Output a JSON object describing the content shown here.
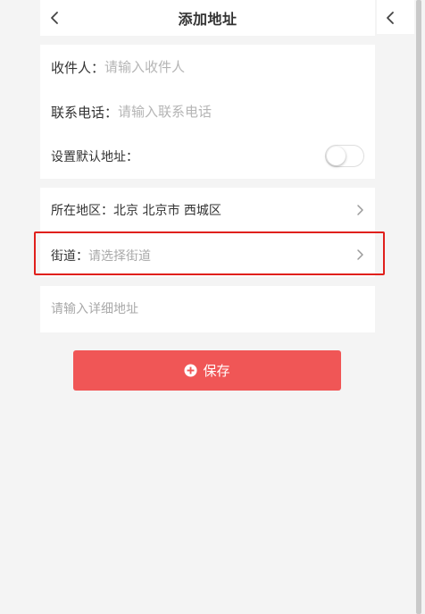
{
  "header": {
    "title": "添加地址",
    "back_icon": "chevron-left-icon"
  },
  "form": {
    "receiver": {
      "label": "收件人：",
      "placeholder": "请输入收件人",
      "value": ""
    },
    "phone": {
      "label": "联系电话：",
      "placeholder": "请输入联系电话",
      "value": ""
    },
    "default_address": {
      "label": "设置默认地址：",
      "enabled": false
    },
    "region": {
      "label": "所在地区：",
      "value": "北京 北京市 西城区"
    },
    "street": {
      "label": "街道：",
      "placeholder": "请选择街道"
    },
    "detail": {
      "placeholder": "请输入详细地址",
      "value": ""
    }
  },
  "save_button": {
    "label": "保存",
    "icon": "plus-circle-icon",
    "color": "#f05656"
  },
  "highlight": {
    "color": "#e0201c"
  }
}
